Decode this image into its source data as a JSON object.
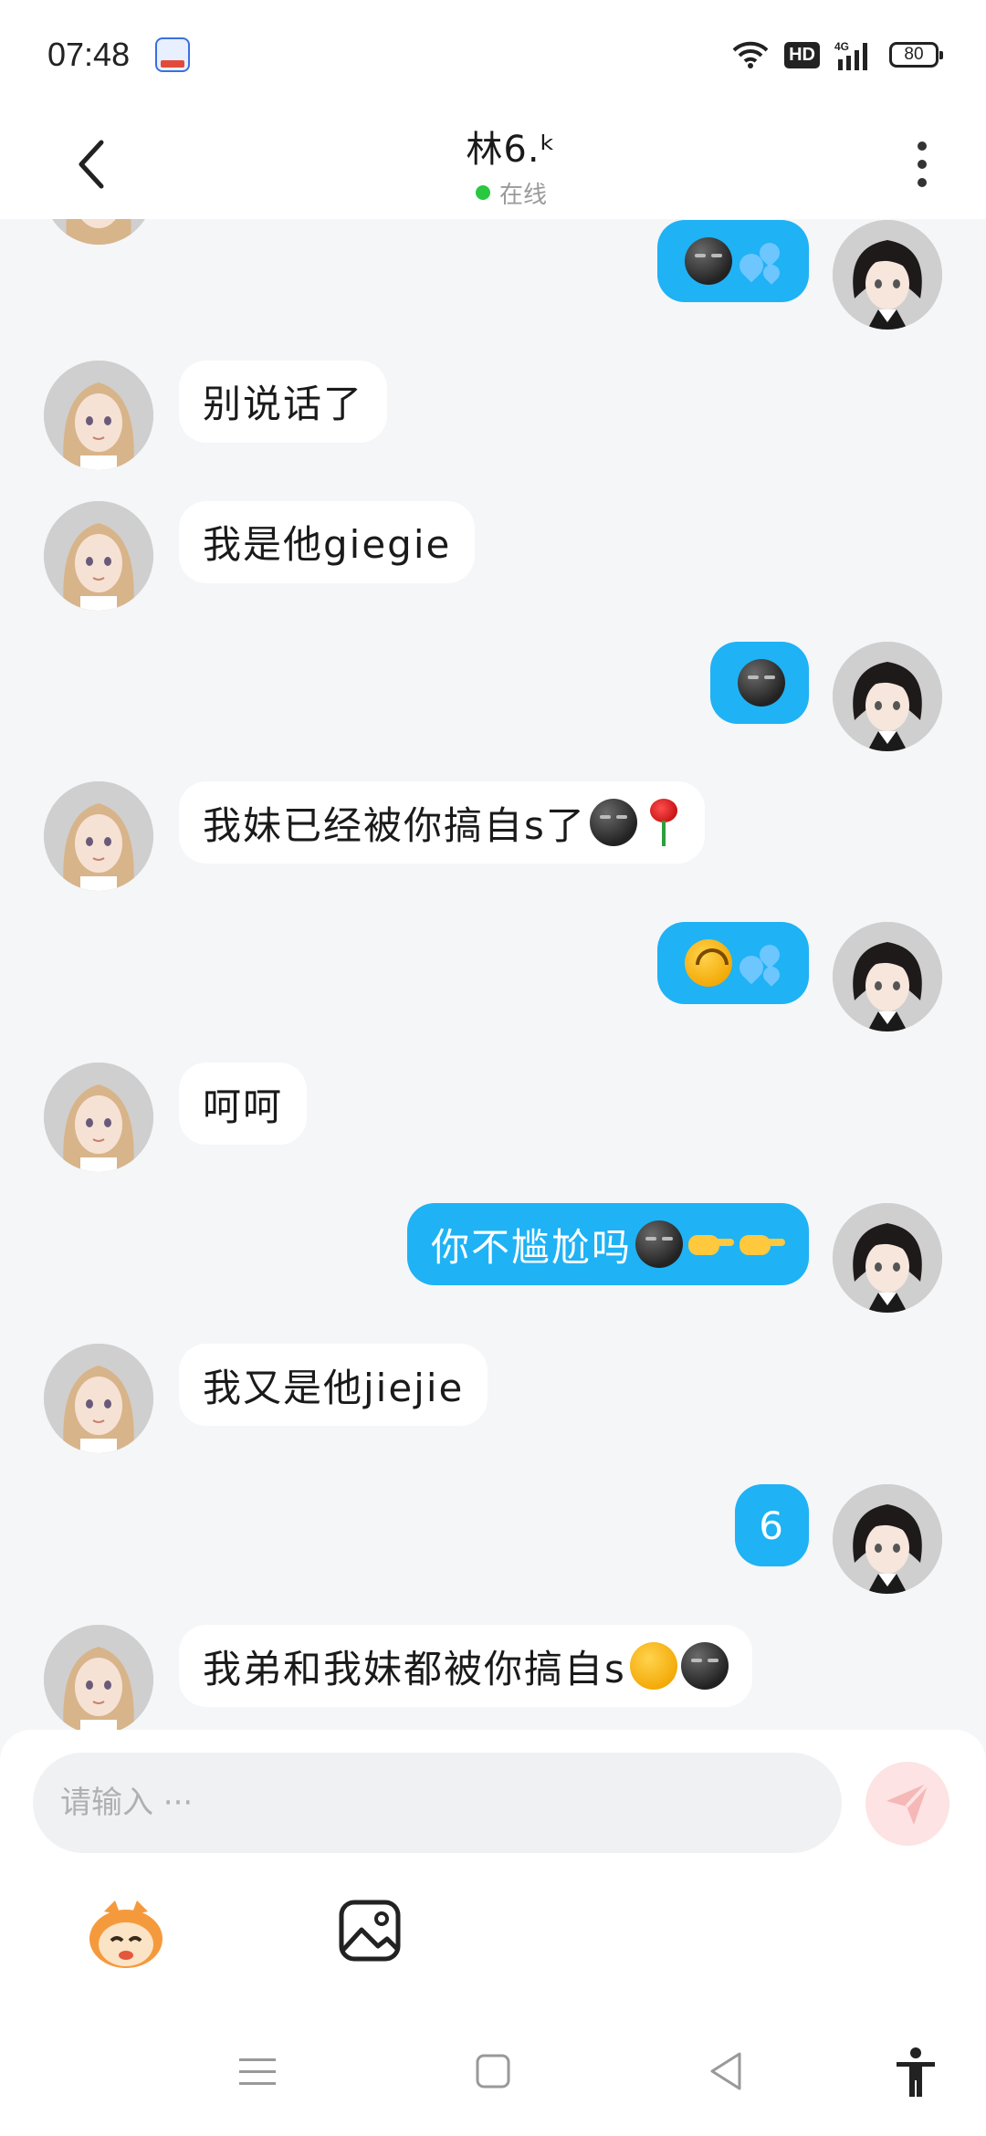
{
  "status_bar": {
    "time": "07:48",
    "app_icon": "baidu-icon",
    "hd": "HD",
    "network": "4G",
    "battery": "80"
  },
  "header": {
    "contact_name": "林6.ᵏ",
    "presence": "在线",
    "back_icon": "chevron-left-icon",
    "more_icon": "more-vertical-icon"
  },
  "messages": [
    {
      "side": "right",
      "text": "",
      "emoji": [
        "smirk",
        "drops"
      ]
    },
    {
      "side": "left",
      "text": "别说话了",
      "emoji": []
    },
    {
      "side": "left",
      "text": "我是他giegie",
      "emoji": []
    },
    {
      "side": "right",
      "text": "",
      "emoji": [
        "smirk"
      ]
    },
    {
      "side": "left",
      "text": "我妹已经被你搞自s了",
      "emoji": [
        "smirk",
        "rose"
      ]
    },
    {
      "side": "right",
      "text": "",
      "emoji": [
        "upside",
        "drops"
      ]
    },
    {
      "side": "left",
      "text": "呵呵",
      "emoji": []
    },
    {
      "side": "right",
      "text": "你不尴尬吗",
      "emoji": [
        "smirk",
        "point",
        "point"
      ]
    },
    {
      "side": "left",
      "text": "我又是他jiejie",
      "emoji": []
    },
    {
      "side": "right",
      "text": "6",
      "emoji": []
    },
    {
      "side": "left",
      "text": "我弟和我妹都被你搞自s",
      "emoji": [
        "smile",
        "smirk"
      ]
    }
  ],
  "composer": {
    "placeholder": "请输入 ···",
    "send_icon": "send-icon",
    "sticker_icon": "sticker-icon",
    "image_icon": "image-icon"
  },
  "nav": {
    "menu_icon": "menu-icon",
    "home_icon": "home-square-icon",
    "back_icon": "back-triangle-icon",
    "accessibility_icon": "accessibility-icon"
  },
  "colors": {
    "outgoing_bubble": "#1fb2f5",
    "incoming_bubble": "#ffffff",
    "background": "#f4f6f8",
    "online": "#28c840"
  }
}
